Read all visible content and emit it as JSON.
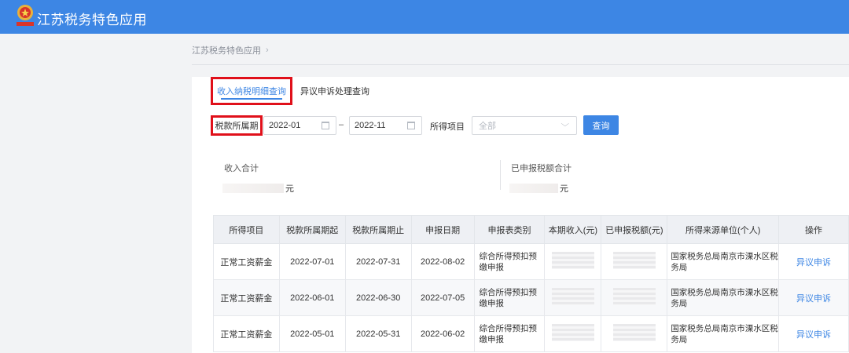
{
  "header": {
    "app_title": "江苏税务特色应用",
    "emblem_icon": "tax-emblem-icon",
    "bar_color": "#3d86e4"
  },
  "breadcrumb": {
    "item": "江苏税务特色应用",
    "separator_icon": "chevron-right-icon"
  },
  "tabs": [
    {
      "label": "收入纳税明细查询",
      "active": true
    },
    {
      "label": "异议申诉处理查询",
      "active": false
    }
  ],
  "filters": {
    "period_label": "税款所属期",
    "start_date": "2022-01",
    "separator": "–",
    "end_date": "2022-11",
    "income_item_label": "所得项目",
    "income_item_value": "全部",
    "query_button": "查询"
  },
  "summary": {
    "income_total_label": "收入合计",
    "income_total_unit": "元",
    "declared_tax_label": "已申报税额合计",
    "declared_tax_unit": "元"
  },
  "table": {
    "columns": [
      "所得项目",
      "税款所属期起",
      "税款所属期止",
      "申报日期",
      "申报表类别",
      "本期收入(元)",
      "已申报税额(元)",
      "所得来源单位(个人)",
      "操作"
    ],
    "rows": [
      {
        "item": "正常工资薪金",
        "period_start": "2022-07-01",
        "period_end": "2022-07-31",
        "declare_date": "2022-08-02",
        "form_type": "综合所得预扣预缴申报",
        "source_unit": "国家税务总局南京市溧水区税务局",
        "action": "异议申诉"
      },
      {
        "item": "正常工资薪金",
        "period_start": "2022-06-01",
        "period_end": "2022-06-30",
        "declare_date": "2022-07-05",
        "form_type": "综合所得预扣预缴申报",
        "source_unit": "国家税务总局南京市溧水区税务局",
        "action": "异议申诉"
      },
      {
        "item": "正常工资薪金",
        "period_start": "2022-05-01",
        "period_end": "2022-05-31",
        "declare_date": "2022-06-02",
        "form_type": "综合所得预扣预缴申报",
        "source_unit": "国家税务总局南京市溧水区税务局",
        "action": "异议申诉"
      }
    ]
  },
  "colors": {
    "accent": "#3d86e4",
    "highlight_box": "#e0101a"
  }
}
